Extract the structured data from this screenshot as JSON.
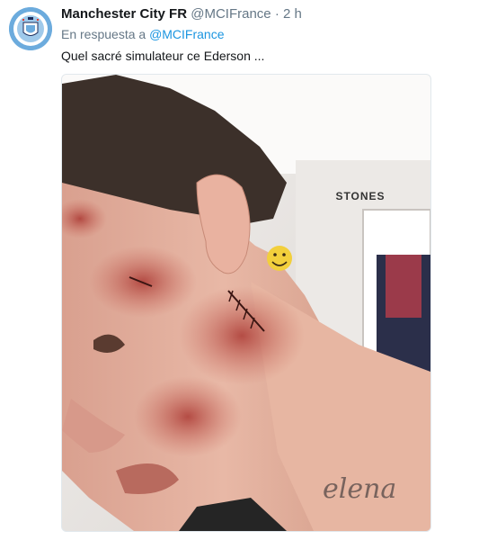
{
  "tweet": {
    "author_name": "Manchester City FR",
    "author_handle": "@MCIFrance",
    "separator": "·",
    "time": "2 h",
    "reply_prefix": "En respuesta a",
    "reply_mention": "@MCIFrance",
    "text": "Quel sacré simulateur ce Ederson ...",
    "avatar_icon": "manchester-city-crest-icon",
    "media": {
      "description_icon": "photo-icon",
      "door_sign": "STONES"
    }
  },
  "colors": {
    "name": "#14171a",
    "secondary": "#657786",
    "link": "#1b95e0",
    "avatar_bg": "#6cabdd"
  }
}
